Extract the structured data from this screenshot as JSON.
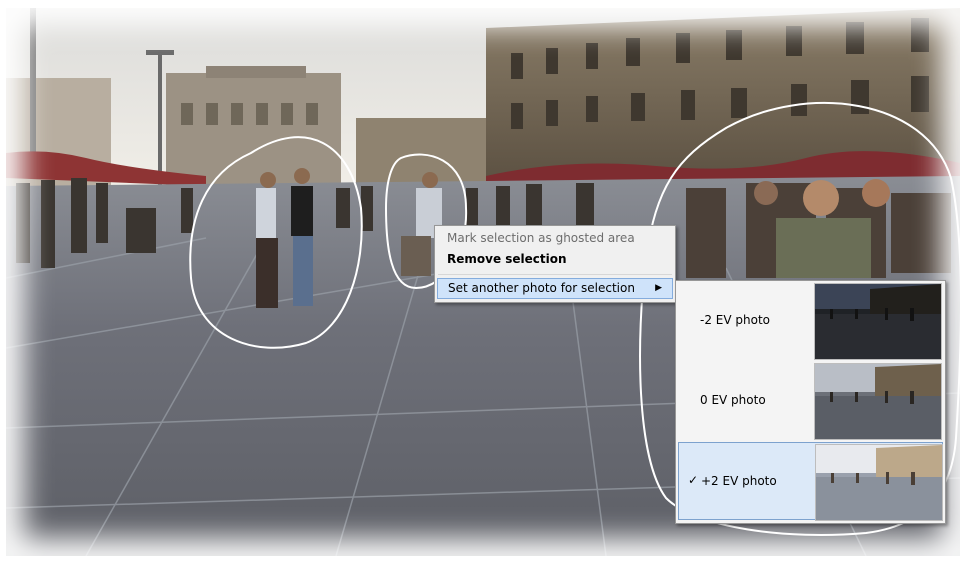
{
  "context_menu": {
    "items": [
      {
        "label": "Mark selection as ghosted area",
        "enabled": false
      },
      {
        "label": "Remove selection",
        "bold": true
      },
      {
        "label": "Set another photo for selection",
        "has_submenu": true,
        "highlighted": true
      }
    ],
    "arrow_icon": "triangle-right-icon"
  },
  "submenu": {
    "items": [
      {
        "label": "-2 EV photo",
        "checked": false,
        "thumbnail": "dark"
      },
      {
        "label": "0 EV photo",
        "checked": false,
        "thumbnail": "normal"
      },
      {
        "label": "+2 EV photo",
        "checked": true,
        "thumbnail": "bright"
      }
    ],
    "check_mark": "✓"
  },
  "colors": {
    "menu_highlight": "#cfe3fa",
    "menu_highlight_border": "#84acdd",
    "submenu_selected": "#dce9f8",
    "selection_outline": "#ffffff"
  }
}
